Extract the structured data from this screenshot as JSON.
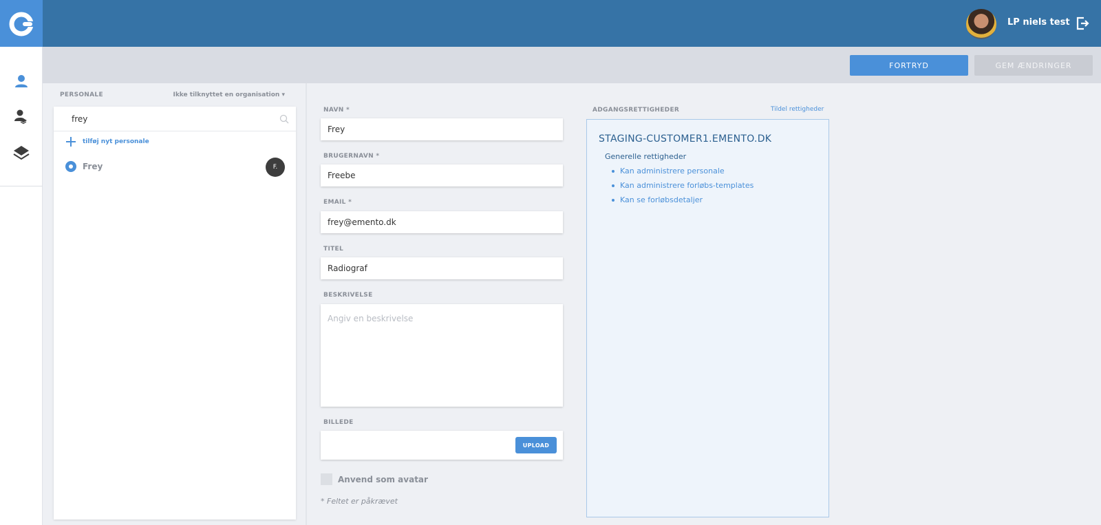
{
  "header": {
    "user_name": "LP niels test"
  },
  "toolbar": {
    "cancel_label": "FORTRYD",
    "save_label": "GEM ÆNDRINGER"
  },
  "staff_list": {
    "header": "PERSONALE",
    "filter_label": "Ikke tilknyttet en organisation ▾",
    "search_value": "frey",
    "add_label": "tilføj nyt personale",
    "items": [
      {
        "name": "Frey",
        "initials": "F."
      }
    ]
  },
  "form": {
    "name_label": "NAVN *",
    "name_value": "Frey",
    "username_label": "BRUGERNAVN *",
    "username_value": "Freebe",
    "email_label": "EMAIL *",
    "email_value": "frey@emento.dk",
    "title_label": "TITEL",
    "title_value": "Radiograf",
    "description_label": "BESKRIVELSE",
    "description_placeholder": "Angiv en beskrivelse",
    "image_label": "BILLEDE",
    "upload_label": "UPLOAD",
    "avatar_checkbox_label": "Anvend som avatar",
    "required_note": "* Feltet er påkrævet"
  },
  "access": {
    "header": "ADGANGSRETTIGHEDER",
    "assign_link": "Tildel rettigheder",
    "domain": "STAGING-CUSTOMER1.EMENTO.DK",
    "group_title": "Generelle rettigheder",
    "permissions": [
      "Kan administrere personale",
      "Kan administrere forløbs-templates",
      "Kan se forløbsdetaljer"
    ]
  },
  "colors": {
    "topbar": "#3673a6",
    "accent": "#4a90d9",
    "disabled_button": "#c9ccd3"
  }
}
